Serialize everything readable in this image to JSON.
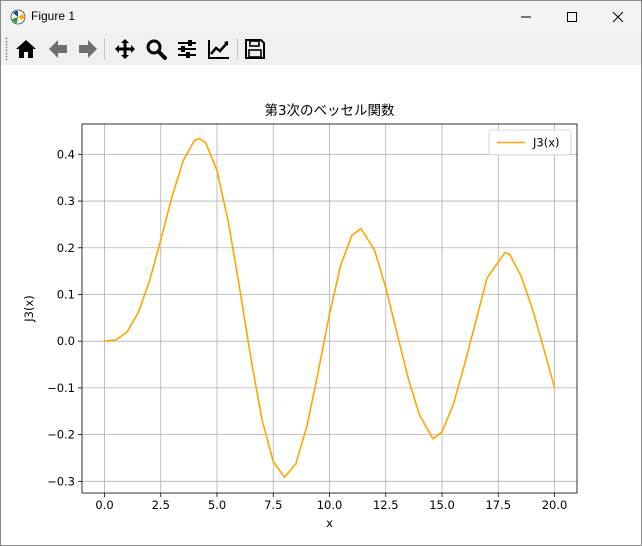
{
  "window": {
    "title": "Figure 1",
    "icons": [
      "matplotlib-icon",
      "minimize-icon",
      "maximize-icon",
      "close-icon"
    ]
  },
  "toolbar": {
    "buttons": [
      "home-icon",
      "back-icon",
      "forward-icon",
      "pan-icon",
      "zoom-icon",
      "configure-subplots-icon",
      "edit-axis-icon",
      "save-icon"
    ]
  },
  "colors": {
    "line": "#ffa500",
    "grid": "#b0b0b0",
    "axes": "#000000"
  },
  "chart_data": {
    "type": "line",
    "title": "第3次のベッセル関数",
    "xlabel": "x",
    "ylabel": "J3(x)",
    "xlim": [
      -1.0,
      21.0
    ],
    "ylim": [
      -0.325,
      0.465
    ],
    "xticks": [
      0.0,
      2.5,
      5.0,
      7.5,
      10.0,
      12.5,
      15.0,
      17.5,
      20.0
    ],
    "xtick_labels": [
      "0.0",
      "2.5",
      "5.0",
      "7.5",
      "10.0",
      "12.5",
      "15.0",
      "17.5",
      "20.0"
    ],
    "yticks": [
      -0.3,
      -0.2,
      -0.1,
      0.0,
      0.1,
      0.2,
      0.3,
      0.4
    ],
    "ytick_labels": [
      "−0.3",
      "−0.2",
      "−0.1",
      "0.0",
      "0.1",
      "0.2",
      "0.3",
      "0.4"
    ],
    "grid": true,
    "legend_position": "top-right",
    "series": [
      {
        "name": "J3(x)",
        "x": [
          0,
          0.5,
          1.0,
          1.5,
          2.0,
          2.5,
          3.0,
          3.5,
          4.0,
          4.2,
          4.5,
          5.0,
          5.5,
          6.0,
          6.5,
          7.0,
          7.5,
          8.0,
          8.5,
          9.0,
          9.5,
          10.0,
          10.5,
          11.0,
          11.4,
          12.0,
          12.5,
          13.0,
          13.5,
          14.0,
          14.6,
          15.0,
          15.5,
          16.0,
          16.5,
          17.0,
          17.8,
          18.0,
          18.5,
          19.0,
          19.5,
          20.0
        ],
        "y": [
          0,
          0.0026,
          0.0196,
          0.061,
          0.129,
          0.217,
          0.309,
          0.387,
          0.43,
          0.434,
          0.425,
          0.365,
          0.256,
          0.115,
          -0.035,
          -0.168,
          -0.258,
          -0.291,
          -0.263,
          -0.181,
          -0.065,
          0.058,
          0.163,
          0.227,
          0.241,
          0.195,
          0.115,
          0.017,
          -0.08,
          -0.158,
          -0.209,
          -0.194,
          -0.136,
          -0.05,
          0.042,
          0.135,
          0.19,
          0.186,
          0.141,
          0.072,
          -0.012,
          -0.099
        ]
      }
    ]
  }
}
